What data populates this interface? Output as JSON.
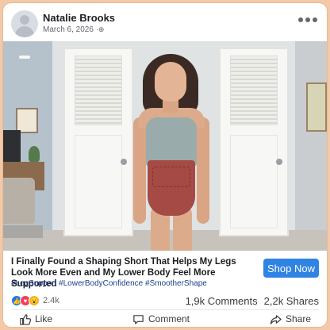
{
  "post": {
    "author": "Natalie Brooks",
    "date": "March 6, 2026",
    "audience_icon": "globe-icon"
  },
  "ad": {
    "headline": "I Finally Found a Shaping Short That Helps My Legs Look More Even and My Lower Body Feel More Supported",
    "hashtags": "#LegSupport #LowerBodyConfidence #SmootherShape",
    "cta_label": "Shop Now"
  },
  "stats": {
    "reaction_icons": [
      "like-icon",
      "love-icon",
      "wow-icon"
    ],
    "reactions_count": "2.4k",
    "comments": "1,9k Comments",
    "shares": "2,2k Shares"
  },
  "actions": {
    "like": "Like",
    "comment": "Comment",
    "share": "Share"
  },
  "colors": {
    "cta": "#2f83e3",
    "hashtag": "#1c3f8f",
    "like_blue": "#1877f2",
    "love_red": "#f33e58",
    "frame": "#f3c9a8"
  }
}
